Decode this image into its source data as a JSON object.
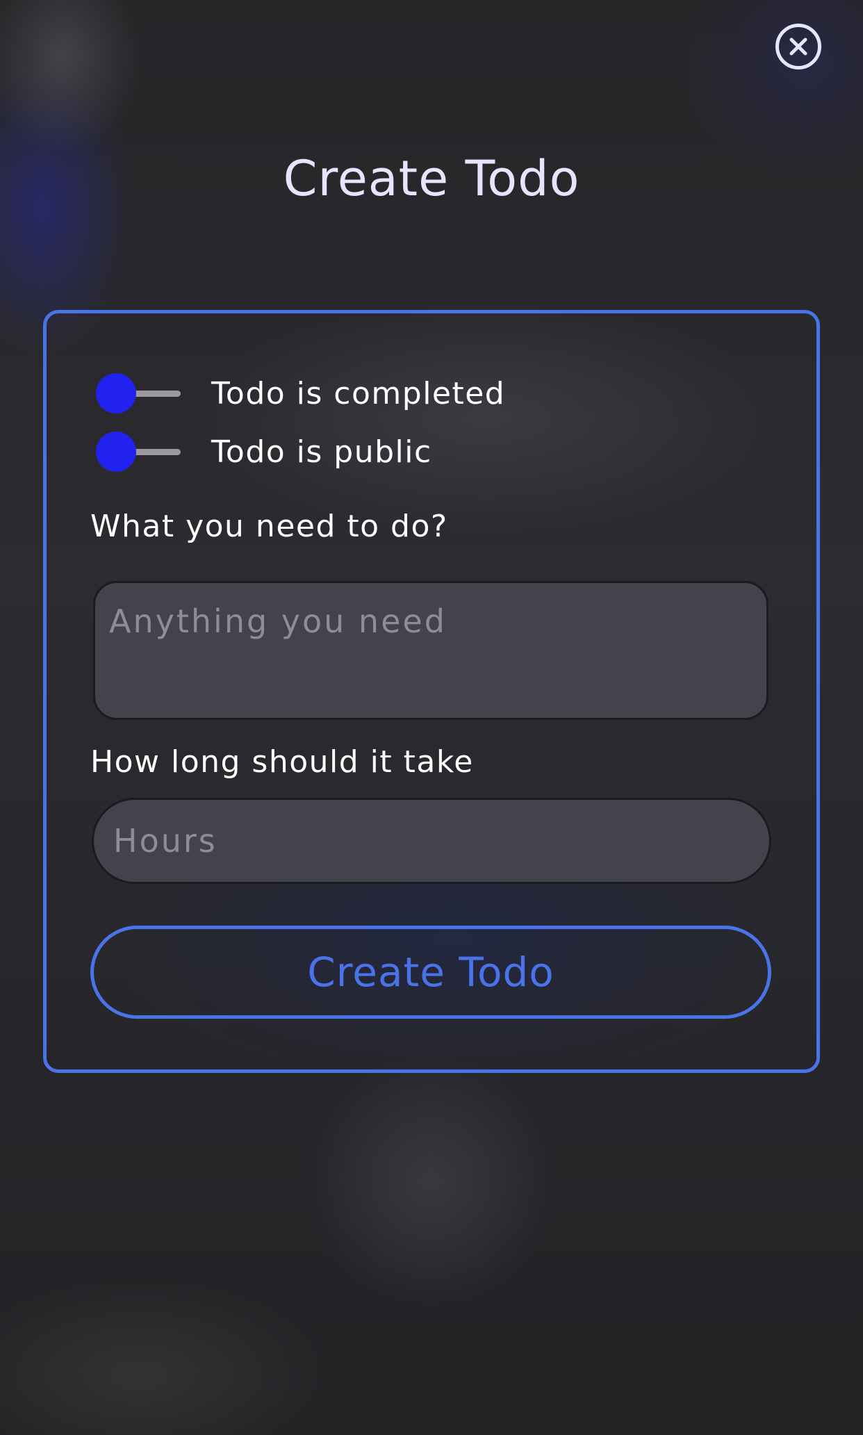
{
  "header": {
    "title": "Create Todo",
    "close_icon": "close-circle-icon"
  },
  "form": {
    "toggles": [
      {
        "label": "Todo is completed",
        "on": false
      },
      {
        "label": "Todo is public",
        "on": false
      }
    ],
    "description": {
      "label": "What you need to do?",
      "placeholder": "Anything you need",
      "value": ""
    },
    "duration": {
      "label": "How long should it take",
      "placeholder": "Hours",
      "value": ""
    },
    "submit_label": "Create Todo"
  },
  "colors": {
    "accent": "#4a73ea",
    "toggle_knob": "#2222ee",
    "title": "#e6e4ff",
    "field_bg": "#43434d",
    "page_bg": "#26262a"
  }
}
